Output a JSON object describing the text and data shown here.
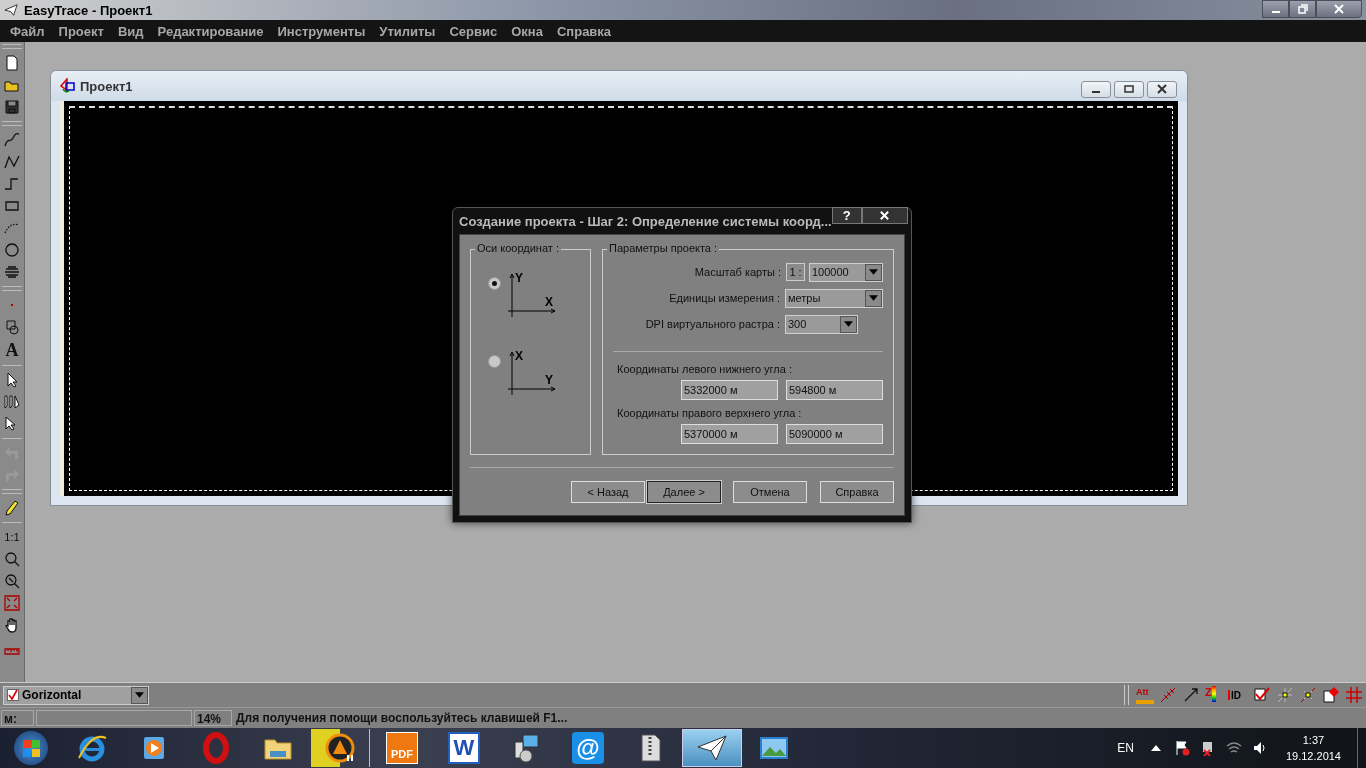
{
  "app_title": "EasyTrace - Проект1",
  "menu": [
    "Файл",
    "Проект",
    "Вид",
    "Редактирование",
    "Инструменты",
    "Утилиты",
    "Сервис",
    "Окна",
    "Справка"
  ],
  "left_toolbar": {
    "text_tool_label": "A",
    "scale_label": "1:1",
    "undo": {
      "disabled": true
    },
    "redo": {
      "disabled": true
    }
  },
  "child_window": {
    "title": "Проект1"
  },
  "dialog": {
    "title": "Создание проекта - Шаг 2: Определение системы коорд...",
    "help": "?",
    "axes_group": {
      "title": "Оси координат :",
      "options": [
        {
          "vertical": "Y",
          "horizontal": "X",
          "selected": true
        },
        {
          "vertical": "X",
          "horizontal": "Y",
          "selected": false
        }
      ]
    },
    "params_group": {
      "title": "Параметры проекта :",
      "scale": {
        "label": "Масштаб карты :",
        "prefix": "1 :",
        "value": "100000"
      },
      "units": {
        "label": "Единицы измерения :",
        "value": "метры"
      },
      "dpi": {
        "label": "DPI виртуального растра :",
        "value": "300"
      },
      "lower_left": {
        "label": "Координаты левого нижнего угла :",
        "x": "5332000 м",
        "y": "594800 м"
      },
      "upper_right": {
        "label": "Координаты правого верхнего угла :",
        "x": "5370000 м",
        "y": "5090000 м"
      }
    },
    "buttons": [
      {
        "label": "< Назад",
        "focused": false
      },
      {
        "label": "Далее >",
        "focused": true
      },
      {
        "label": "Отмена",
        "focused": false
      },
      {
        "label": "Справка",
        "focused": false
      }
    ]
  },
  "layer_bar": {
    "layer": "Gorizontal",
    "checked": true,
    "tools": [
      {
        "kind": "att",
        "label": "Att"
      },
      {
        "kind": "hatch-line"
      },
      {
        "kind": "arrow"
      },
      {
        "kind": "z",
        "label": "Z"
      },
      {
        "kind": "id",
        "label": "ID"
      },
      {
        "kind": "check"
      },
      {
        "kind": "node"
      },
      {
        "kind": "node-line"
      },
      {
        "kind": "fill"
      },
      {
        "kind": "grid"
      }
    ]
  },
  "status_bar": {
    "coord_label": "м:",
    "zoom": "14%",
    "message": "Для получения помощи воспользуйтесь клавишей F1..."
  },
  "taskbar": {
    "items": [
      {
        "kind": "ie",
        "selected": false,
        "attention": false
      },
      {
        "kind": "media",
        "selected": false,
        "attention": false
      },
      {
        "kind": "opera",
        "selected": false,
        "attention": false
      },
      {
        "kind": "explorer",
        "selected": false,
        "attention": false
      },
      {
        "kind": "aimp",
        "selected": false,
        "attention": true
      },
      {
        "kind": "pdf",
        "label": "PDF",
        "selected": false,
        "attention": false
      },
      {
        "kind": "word",
        "label": "W",
        "selected": false,
        "attention": false
      },
      {
        "kind": "installer",
        "selected": false,
        "attention": false
      },
      {
        "kind": "mail",
        "label": "@",
        "selected": false,
        "attention": false
      },
      {
        "kind": "zip",
        "selected": false,
        "attention": false
      },
      {
        "kind": "plane",
        "selected": true,
        "attention": false
      },
      {
        "kind": "photos",
        "selected": false,
        "attention": false
      }
    ],
    "language": "EN",
    "time": "1:37",
    "date": "19.12.2014"
  }
}
